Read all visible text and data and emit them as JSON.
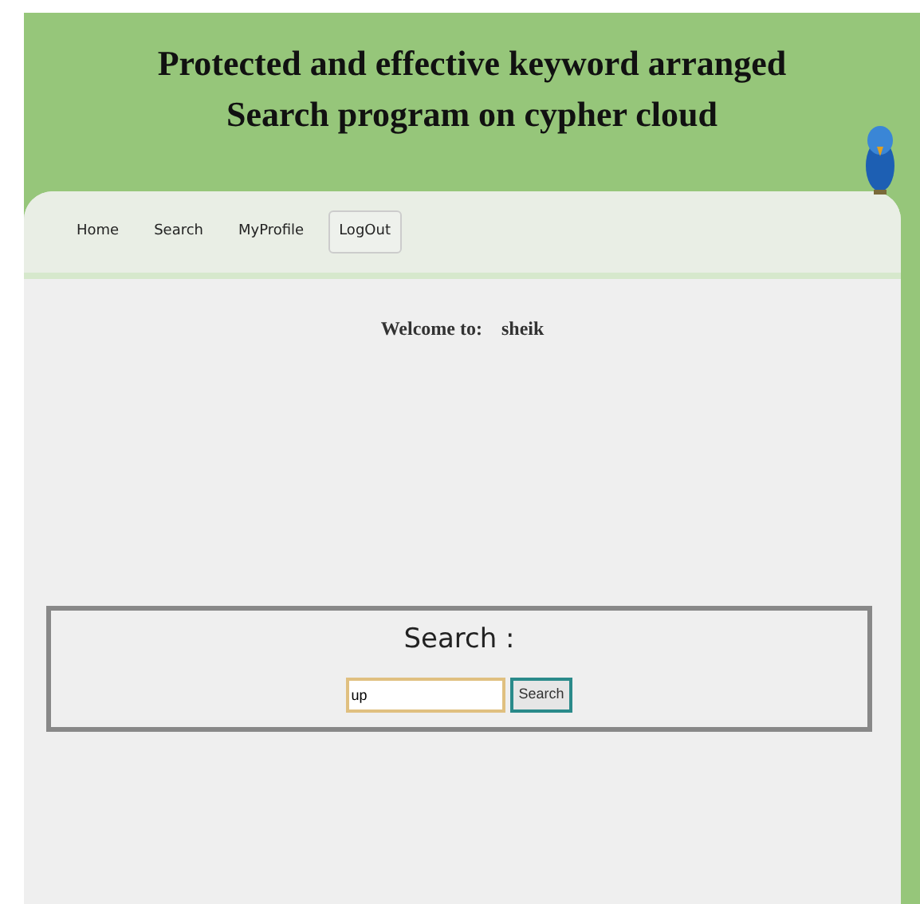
{
  "header": {
    "title": "Protected and effective keyword arranged Search program on cypher cloud"
  },
  "nav": [
    {
      "label": "Home",
      "selected": false
    },
    {
      "label": "Search",
      "selected": false
    },
    {
      "label": "MyProfile",
      "selected": false
    },
    {
      "label": "LogOut",
      "selected": true
    }
  ],
  "welcome": {
    "label": "Welcome to:",
    "user": "sheik"
  },
  "search_panel": {
    "heading": "Search :",
    "value": "up",
    "button": "Search"
  }
}
